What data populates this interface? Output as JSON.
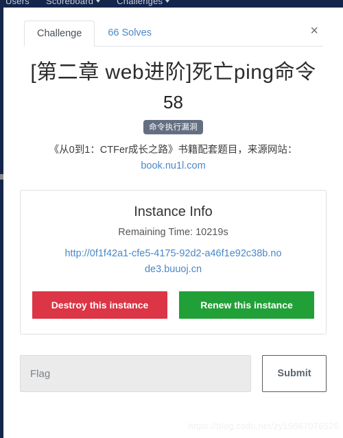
{
  "navbar": {
    "items": [
      {
        "label": "Users",
        "has_caret": false
      },
      {
        "label": "Scoreboard",
        "has_caret": true
      },
      {
        "label": "Challenges",
        "has_caret": true
      }
    ]
  },
  "modal": {
    "tabs": [
      {
        "label": "Challenge",
        "active": true
      },
      {
        "label": "66 Solves",
        "active": false
      }
    ],
    "close_label": "×",
    "challenge": {
      "title": "[第二章 web进阶]死亡ping命令",
      "points": "58",
      "category_badge": "命令执行漏洞",
      "description": "《从0到1：CTFer成长之路》书籍配套题目，来源网站：",
      "description_link": "book.nu1l.com"
    },
    "instance": {
      "title": "Instance Info",
      "remaining_time": "Remaining Time: 10219s",
      "url": "http://0f1f42a1-cfe5-4175-92d2-a46f1e92c38b.node3.buuoj.cn",
      "destroy_label": "Destroy this instance",
      "renew_label": "Renew this instance",
      "destroy_color": "#dc3545",
      "renew_color": "#21a038"
    },
    "flag_form": {
      "placeholder": "Flag",
      "value": "",
      "submit_label": "Submit"
    }
  },
  "watermark": "https://blog.csdn.net/zy15667076526",
  "colors": {
    "navbar_bg": "#14264c",
    "link": "#4a87c7",
    "badge_bg": "#636f81"
  }
}
